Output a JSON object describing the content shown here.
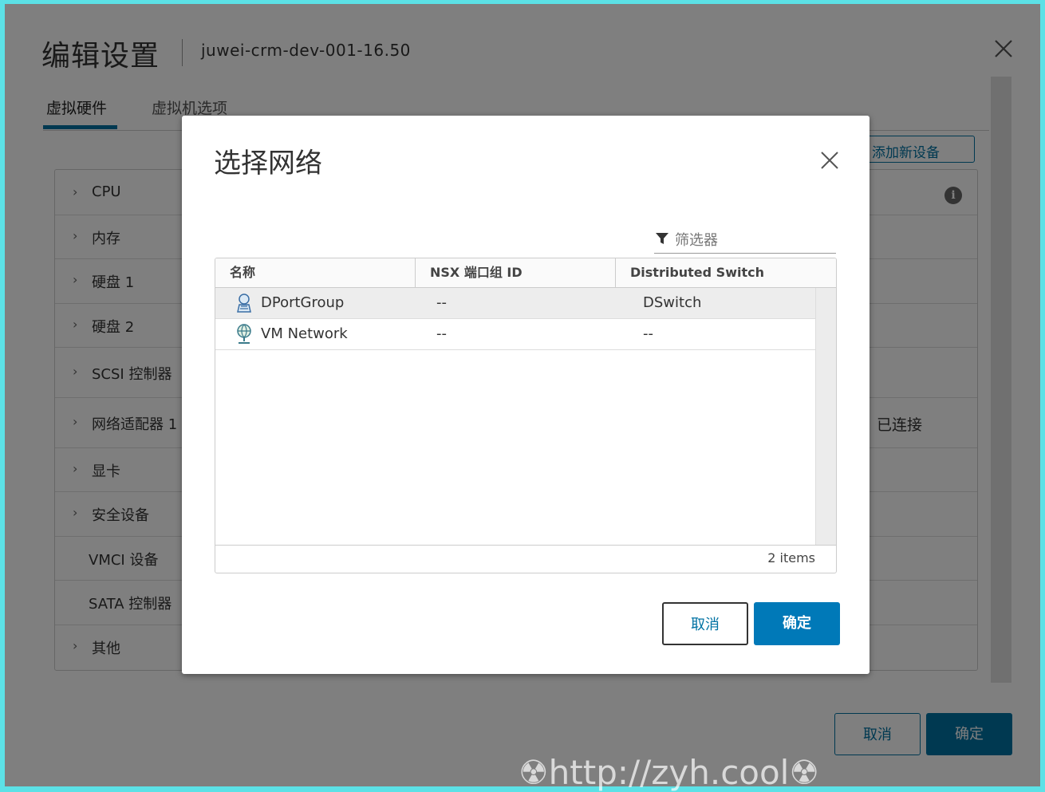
{
  "background": {
    "title": "编辑设置",
    "vm_name": "juwei-crm-dev-001-16.50",
    "tabs": [
      {
        "label": "虚拟硬件"
      },
      {
        "label": "虚拟机选项"
      }
    ],
    "add_device_label": "添加新设备",
    "hardware_items": [
      {
        "label": "CPU"
      },
      {
        "label": "内存"
      },
      {
        "label": "硬盘 1"
      },
      {
        "label": "硬盘 2"
      },
      {
        "label": "SCSI 控制器"
      },
      {
        "label": "网络适配器 1"
      },
      {
        "label": "显卡"
      },
      {
        "label": "安全设备"
      },
      {
        "label": "VMCI 设备"
      },
      {
        "label": "SATA 控制器"
      },
      {
        "label": "其他"
      }
    ],
    "connected_label": "已连接",
    "cancel_label": "取消",
    "ok_label": "确定",
    "watermark": "☢http://zyh.cool☢"
  },
  "modal": {
    "title": "选择网络",
    "filter_placeholder": "筛选器",
    "columns": [
      {
        "label": "名称"
      },
      {
        "label": "NSX 端口组 ID"
      },
      {
        "label": "Distributed Switch"
      }
    ],
    "rows": [
      {
        "name": "DPortGroup",
        "nsx_id": "--",
        "switch": "DSwitch",
        "icon": "distributed-portgroup-icon",
        "selected": true
      },
      {
        "name": "VM Network",
        "nsx_id": "--",
        "switch": "--",
        "icon": "standard-network-icon",
        "selected": false
      }
    ],
    "item_count": "2 items",
    "cancel_label": "取消",
    "ok_label": "确定"
  },
  "colors": {
    "accent": "#0072a3",
    "frame": "#5ce1e6"
  }
}
